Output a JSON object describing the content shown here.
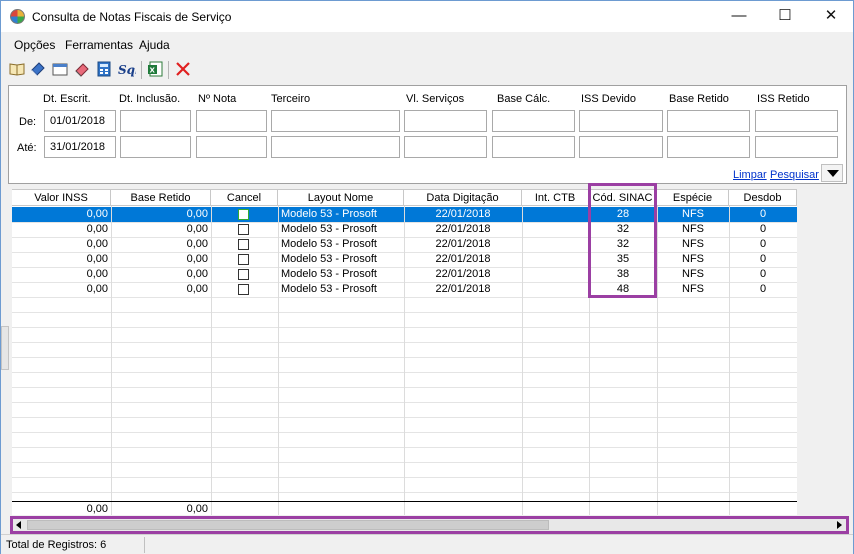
{
  "window": {
    "title": "Consulta de Notas Fiscais de Serviço",
    "controls": {
      "minimize": "—",
      "maximize": "☐",
      "close": "✕"
    }
  },
  "menu": [
    "Opções",
    "Ferramentas",
    "Ajuda"
  ],
  "toolbar": {
    "icons": [
      "open-book-icon",
      "book-icon",
      "window-icon",
      "eraser-icon",
      "calculator-icon",
      "script-icon",
      "excel-export-icon",
      "delete-icon"
    ]
  },
  "filter": {
    "labels": {
      "dt_escrit": "Dt. Escrit.",
      "dt_inclusao": "Dt. Inclusão.",
      "nota": "Nº Nota",
      "terceiro": "Terceiro",
      "vl_servicos": "Vl. Serviços",
      "base_calc": "Base Cálc.",
      "iss_devido": "ISS Devido",
      "base_retido": "Base Retido",
      "iss_retido": "ISS Retido"
    },
    "row_from": "De:",
    "row_to": "Até:",
    "from_date": "01/01/2018",
    "to_date": "31/01/2018",
    "limpar": "Limpar",
    "pesquisar": "Pesquisar"
  },
  "grid": {
    "headers": [
      "Valor INSS",
      "Base Retido",
      "Cancel",
      "Layout Nome",
      "Data Digitação",
      "Int. CTB",
      "Cód. SINAC",
      "Espécie",
      "Desdob"
    ],
    "rows": [
      {
        "valor_inss": "0,00",
        "base_retido": "0,00",
        "layout": "Modelo 53 - Prosoft",
        "data": "22/01/2018",
        "int_ctb": "",
        "sinac": "28",
        "especie": "NFS",
        "desdob": "0"
      },
      {
        "valor_inss": "0,00",
        "base_retido": "0,00",
        "layout": "Modelo 53 - Prosoft",
        "data": "22/01/2018",
        "int_ctb": "",
        "sinac": "32",
        "especie": "NFS",
        "desdob": "0"
      },
      {
        "valor_inss": "0,00",
        "base_retido": "0,00",
        "layout": "Modelo 53 - Prosoft",
        "data": "22/01/2018",
        "int_ctb": "",
        "sinac": "32",
        "especie": "NFS",
        "desdob": "0"
      },
      {
        "valor_inss": "0,00",
        "base_retido": "0,00",
        "layout": "Modelo 53 - Prosoft",
        "data": "22/01/2018",
        "int_ctb": "",
        "sinac": "35",
        "especie": "NFS",
        "desdob": "0"
      },
      {
        "valor_inss": "0,00",
        "base_retido": "0,00",
        "layout": "Modelo 53 - Prosoft",
        "data": "22/01/2018",
        "int_ctb": "",
        "sinac": "38",
        "especie": "NFS",
        "desdob": "0"
      },
      {
        "valor_inss": "0,00",
        "base_retido": "0,00",
        "layout": "Modelo 53 - Prosoft",
        "data": "22/01/2018",
        "int_ctb": "",
        "sinac": "48",
        "especie": "NFS",
        "desdob": "0"
      }
    ],
    "totals": {
      "valor_inss": "0,00",
      "base_retido": "0,00"
    },
    "selected_row": 0
  },
  "status": {
    "total": "Total de Registros: 6"
  },
  "colors": {
    "selection": "#0078d7",
    "highlight": "#9b3fa3",
    "link": "#0033cc",
    "delete": "#e02020"
  }
}
